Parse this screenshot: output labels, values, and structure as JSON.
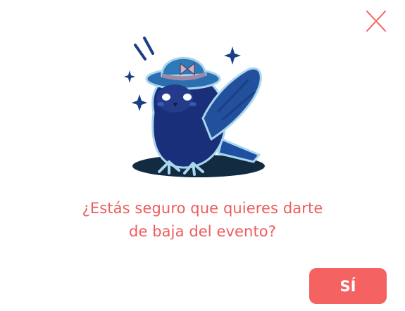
{
  "dialog": {
    "message_line1": "¿Estás seguro que quieres darte",
    "message_line2": "de baja del evento?",
    "confirm_label": "SÍ",
    "close_icon": "close-x-icon",
    "illustration": "bird-with-hat-illustration"
  },
  "colors": {
    "accent": "#f46262",
    "text": "#ef5b5b",
    "bird": "#1a3f86",
    "background": "#ffffff"
  }
}
